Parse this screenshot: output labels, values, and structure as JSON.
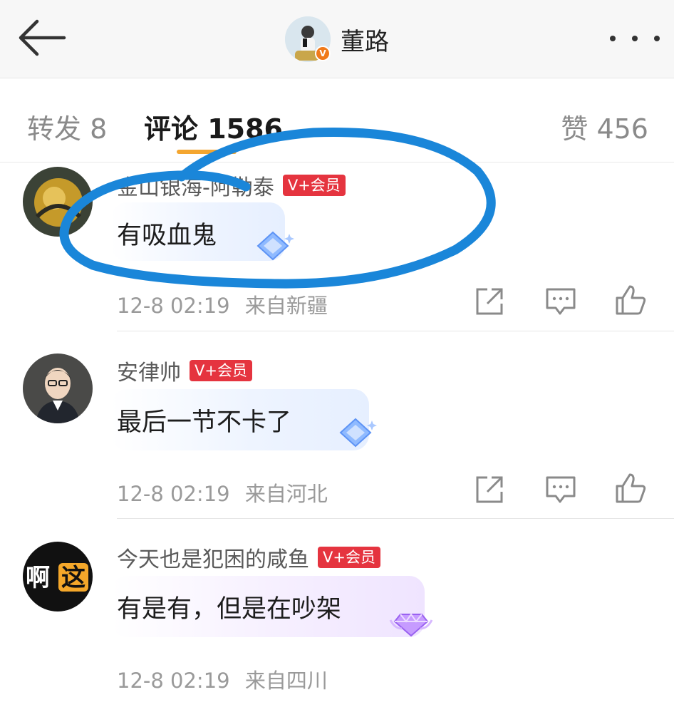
{
  "header": {
    "title": "董路",
    "verified_badge": "V"
  },
  "tabs": {
    "repost": "转发 8",
    "comments": "评论 1586",
    "likes": "赞 456",
    "active": "comments"
  },
  "comments": [
    {
      "username": "金山银海-阿勒泰",
      "vip": "V+会员",
      "text": "有吸血鬼",
      "time": "12-8 02:19",
      "location": "来自新疆",
      "gem_color": "#7fb1ff"
    },
    {
      "username": "安律帅",
      "vip": "V+会员",
      "text": "最后一节不卡了",
      "time": "12-8 02:19",
      "location": "来自河北",
      "gem_color": "#7fb1ff"
    },
    {
      "username": "今天也是犯困的咸鱼",
      "vip": "V+会员",
      "text": "有是有，但是在吵架",
      "time": "12-8 02:19",
      "location": "来自四川",
      "gem_color": "#b884ff",
      "avatar_text_1": "啊",
      "avatar_text_2": "这"
    }
  ],
  "icons": [
    "back-arrow-icon",
    "more-dots-icon",
    "share-icon",
    "comment-icon",
    "like-icon",
    "diamond-icon"
  ],
  "colors": {
    "vip_badge": "#e5343f",
    "tab_underline": "#f4a630",
    "annotation_circle": "#1a86d9"
  }
}
